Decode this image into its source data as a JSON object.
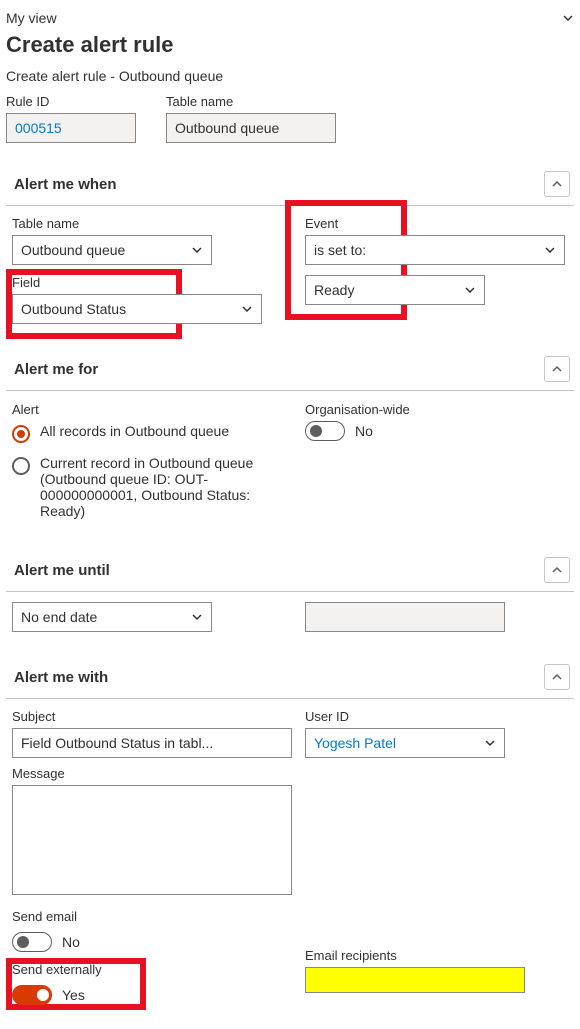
{
  "view": {
    "label": "My view"
  },
  "page": {
    "title": "Create alert rule",
    "breadcrumb": "Create alert rule - Outbound queue"
  },
  "header_fields": {
    "rule_id": {
      "label": "Rule ID",
      "value": "000515"
    },
    "table_name": {
      "label": "Table name",
      "value": "Outbound queue"
    }
  },
  "sections": {
    "alert_when": {
      "title": "Alert me when",
      "table_name": {
        "label": "Table name",
        "value": "Outbound queue"
      },
      "field": {
        "label": "Field",
        "value": "Outbound Status"
      },
      "event": {
        "label": "Event",
        "value": "is set to:",
        "value2": "Ready"
      }
    },
    "alert_for": {
      "title": "Alert me for",
      "alert_label": "Alert",
      "options": {
        "all": "All records in Outbound queue",
        "current": "Current record in Outbound queue (Outbound queue ID: OUT-000000000001, Outbound Status: Ready)"
      },
      "org_wide": {
        "label": "Organisation-wide",
        "value": "No"
      }
    },
    "alert_until": {
      "title": "Alert me until",
      "value": "No end date"
    },
    "alert_with": {
      "title": "Alert me with",
      "subject": {
        "label": "Subject",
        "value": "Field Outbound Status in tabl..."
      },
      "user_id": {
        "label": "User ID",
        "value": "Yogesh Patel"
      },
      "message_label": "Message",
      "send_email": {
        "label": "Send email",
        "value": "No"
      },
      "email_recipients": {
        "label": "Email recipients"
      },
      "send_externally": {
        "label": "Send externally",
        "value": "Yes"
      }
    }
  }
}
